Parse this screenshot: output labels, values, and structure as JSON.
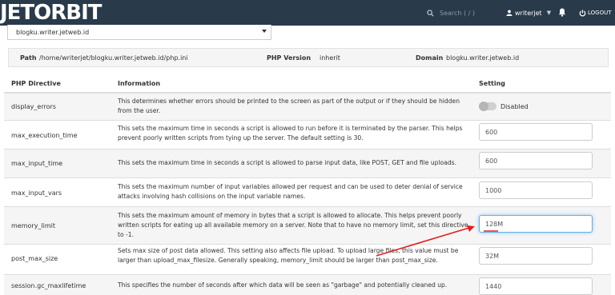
{
  "header": {
    "logo_text": "JETORBIT",
    "search_placeholder": "Search ( / )",
    "username": "writerjet",
    "logout_label": "LOGOUT"
  },
  "domain_select": {
    "selected": "blogku.writer.jetweb.id"
  },
  "info": {
    "path_label": "Path",
    "path_value": "/home/writerjet/blogku.writer.jetweb.id/php.ini",
    "php_version_label": "PHP Version",
    "php_version_value": "inherit",
    "domain_label": "Domain",
    "domain_value": "blogku.writer.jetweb.id"
  },
  "table": {
    "headers": {
      "directive": "PHP Directive",
      "information": "Information",
      "setting": "Setting"
    },
    "rows": [
      {
        "directive": "display_errors",
        "info": "This determines whether errors should be printed to the screen as part of the output or if they should be hidden from the user.",
        "toggle_label": "Disabled",
        "toggle_on": false
      },
      {
        "directive": "max_execution_time",
        "info": "This sets the maximum time in seconds a script is allowed to run before it is terminated by the parser. This helps prevent poorly written scripts from tying up the server. The default setting is 30.",
        "value": "600"
      },
      {
        "directive": "max_input_time",
        "info": "This sets the maximum time in seconds a script is allowed to parse input data, like POST, GET and file uploads.",
        "value": "600"
      },
      {
        "directive": "max_input_vars",
        "info": "This sets the maximum number of input variables allowed per request and can be used to deter denial of service attacks involving hash collisions on the input variable names.",
        "value": "1000"
      },
      {
        "directive": "memory_limit",
        "info": "This sets the maximum amount of memory in bytes that a script is allowed to allocate. This helps prevent poorly written scripts for eating up all available memory on a server. Note that to have no memory limit, set this directive to -1.",
        "value": "128M"
      },
      {
        "directive": "post_max_size",
        "info": "Sets max size of post data allowed. This setting also affects file upload. To upload large files, this value must be larger than upload_max_filesize. Generally speaking, memory_limit should be larger than post_max_size.",
        "value": "32M"
      },
      {
        "directive": "session.gc_maxlifetime",
        "info": "This specifies the number of seconds after which data will be seen as \"garbage\" and potentially cleaned up.",
        "value": "1440"
      }
    ]
  },
  "colors": {
    "topbar": "#293a4a",
    "annotation": "#e02020",
    "focus": "#66afe9"
  }
}
